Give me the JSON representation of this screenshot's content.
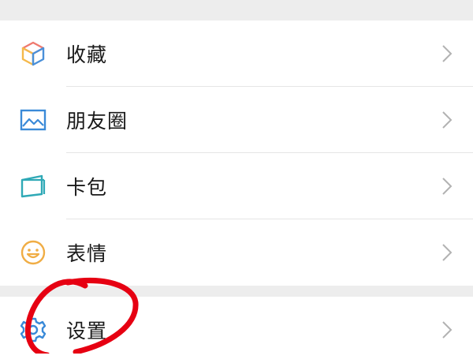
{
  "menu_group_1": [
    {
      "name": "favorites",
      "label": "收藏",
      "icon": "cube-icon"
    },
    {
      "name": "moments",
      "label": "朋友圈",
      "icon": "picture-icon"
    },
    {
      "name": "cards",
      "label": "卡包",
      "icon": "card-wallet-icon"
    },
    {
      "name": "stickers",
      "label": "表情",
      "icon": "smiley-icon"
    }
  ],
  "menu_group_2": [
    {
      "name": "settings",
      "label": "设置",
      "icon": "gear-icon"
    }
  ],
  "colors": {
    "background": "#ededed",
    "row": "#ffffff",
    "text": "#191919",
    "chevron": "#b2b2b2",
    "annotation": "#e60012"
  }
}
